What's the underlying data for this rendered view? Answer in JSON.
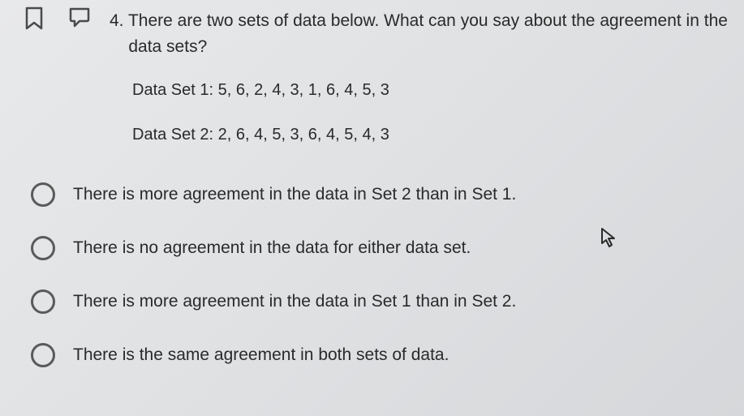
{
  "question": {
    "number": "4.",
    "text_line1": "There are two sets of data below.  What can you say about the agreement in the",
    "text_line2": "data sets?",
    "data_set_1": "Data Set 1: 5, 6, 2, 4, 3, 1, 6, 4, 5, 3",
    "data_set_2": "Data Set 2: 2, 6, 4, 5, 3, 6, 4, 5, 4, 3"
  },
  "options": [
    {
      "label": "There is more agreement in the data in Set 2 than in Set 1."
    },
    {
      "label": "There is no agreement in the data for either data set."
    },
    {
      "label": "There is more agreement in the data in Set 1 than in Set 2."
    },
    {
      "label": "There is the same agreement in both sets of data."
    }
  ]
}
